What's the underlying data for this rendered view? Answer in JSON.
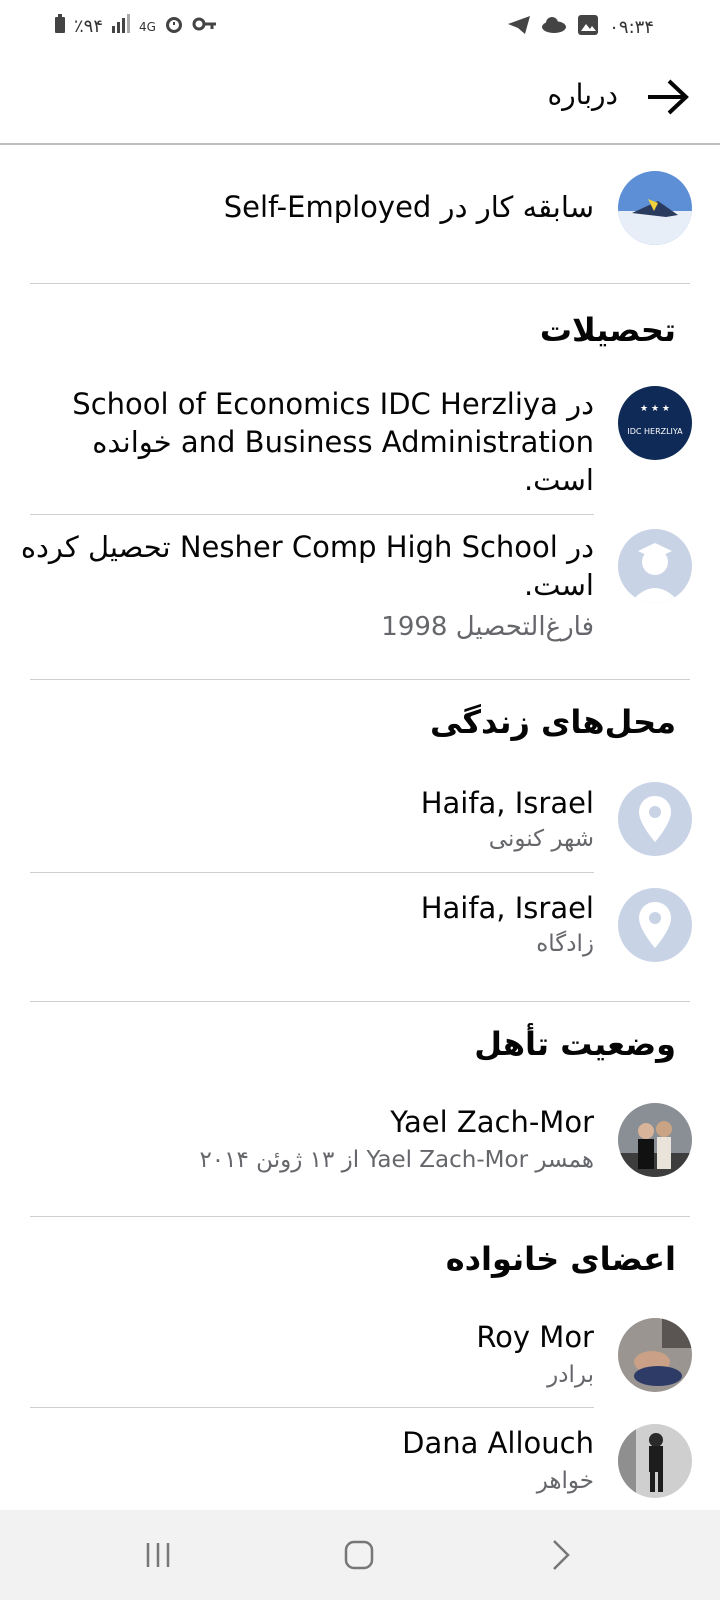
{
  "status_bar": {
    "battery": "٪۹۴",
    "network": "4G",
    "time": "۰۹:۳۴"
  },
  "header": {
    "title": "درباره"
  },
  "work": {
    "text": "سابقه کار در Self-Employed"
  },
  "education": {
    "title": "تحصیلات",
    "items": [
      {
        "line1": "در School of Economics IDC Herzliya",
        "line2": "and Business Administration خوانده",
        "line3": "است."
      },
      {
        "line1": "در Nesher Comp High School تحصیل کرده",
        "line2": "است.",
        "sub": "فارغ‌التحصیل 1998"
      }
    ]
  },
  "places": {
    "title": "محل‌های زندگی",
    "items": [
      {
        "name": "Haifa, Israel",
        "sub": "شهر کنونی"
      },
      {
        "name": "Haifa, Israel",
        "sub": "زادگاه"
      }
    ]
  },
  "relationship": {
    "title": "وضعیت تأهل",
    "name": "Yael Zach-Mor",
    "sub": "همسر Yael Zach-Mor از ۱۳ ژوئن ۲۰۱۴"
  },
  "family": {
    "title": "اعضای خانواده",
    "items": [
      {
        "name": "Roy Mor",
        "sub": "برادر"
      },
      {
        "name": "Dana Allouch",
        "sub": "خواهر"
      }
    ]
  },
  "colors": {
    "accent": "#050505",
    "muted": "#65676b",
    "pin_bg": "#c9d3e6"
  },
  "icons": [
    "back-arrow-icon",
    "location-pin-icon",
    "graduation-cap-icon",
    "recent-apps-icon",
    "home-icon",
    "back-nav-icon"
  ]
}
